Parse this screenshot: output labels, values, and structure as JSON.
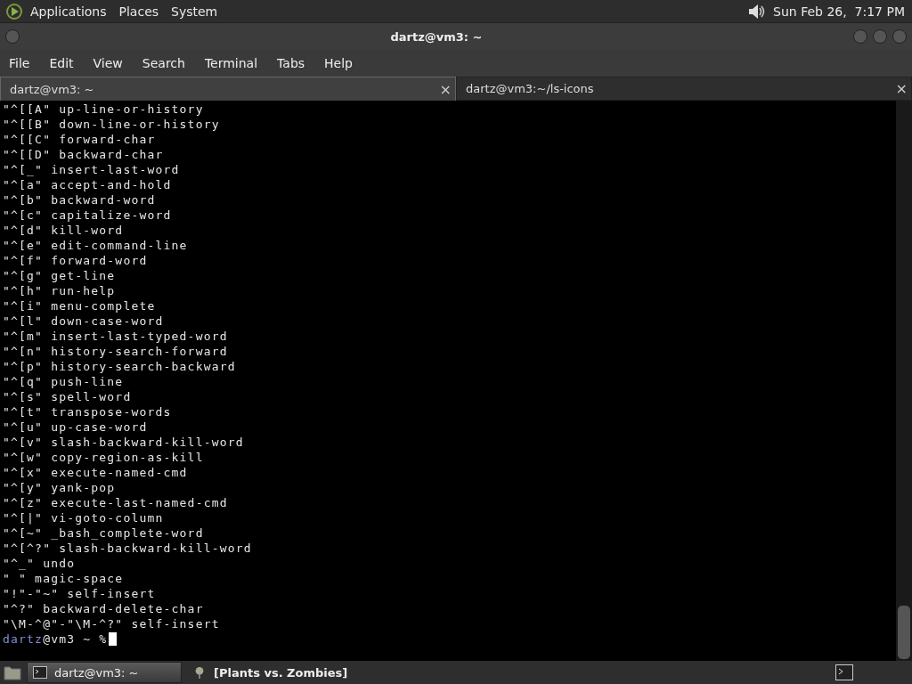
{
  "top_panel": {
    "menus": [
      "Applications",
      "Places",
      "System"
    ],
    "clock": "Sun Feb 26,  7:17 PM"
  },
  "window": {
    "title": "dartz@vm3: ~"
  },
  "menu_bar": [
    "File",
    "Edit",
    "View",
    "Search",
    "Terminal",
    "Tabs",
    "Help"
  ],
  "tabs": [
    {
      "label": "dartz@vm3: ~",
      "selected": true,
      "close": "×"
    },
    {
      "label": "dartz@vm3:~/ls-icons",
      "selected": false,
      "close": "×"
    }
  ],
  "terminal": {
    "lines": [
      "\"^[[A\" up-line-or-history",
      "\"^[[B\" down-line-or-history",
      "\"^[[C\" forward-char",
      "\"^[[D\" backward-char",
      "\"^[_\" insert-last-word",
      "\"^[a\" accept-and-hold",
      "\"^[b\" backward-word",
      "\"^[c\" capitalize-word",
      "\"^[d\" kill-word",
      "\"^[e\" edit-command-line",
      "\"^[f\" forward-word",
      "\"^[g\" get-line",
      "\"^[h\" run-help",
      "\"^[i\" menu-complete",
      "\"^[l\" down-case-word",
      "\"^[m\" insert-last-typed-word",
      "\"^[n\" history-search-forward",
      "\"^[p\" history-search-backward",
      "\"^[q\" push-line",
      "\"^[s\" spell-word",
      "\"^[t\" transpose-words",
      "\"^[u\" up-case-word",
      "\"^[v\" slash-backward-kill-word",
      "\"^[w\" copy-region-as-kill",
      "\"^[x\" execute-named-cmd",
      "\"^[y\" yank-pop",
      "\"^[z\" execute-last-named-cmd",
      "\"^[|\" vi-goto-column",
      "\"^[~\" _bash_complete-word",
      "\"^[^?\" slash-backward-kill-word",
      "\"^_\" undo",
      "\" \" magic-space",
      "\"!\"-\"~\" self-insert",
      "\"^?\" backward-delete-char",
      "\"\\M-^@\"-\"\\M-^?\" self-insert"
    ],
    "prompt": {
      "user": "dartz",
      "rest": "@vm3 ~ %"
    }
  },
  "taskbar": {
    "windows": [
      {
        "label": "dartz@vm3: ~",
        "selected": true,
        "kind": "terminal"
      },
      {
        "label": "[Plants vs. Zombies]",
        "selected": false,
        "kind": "game"
      }
    ]
  }
}
